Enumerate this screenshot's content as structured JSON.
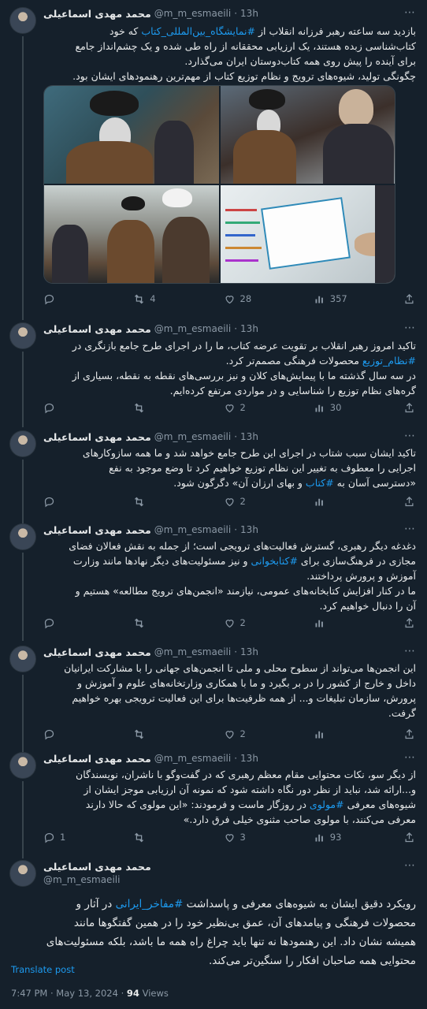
{
  "author": {
    "name": "محمد مهدی اسماعیلی",
    "handle": "@m_m_esmaeili"
  },
  "tweets": [
    {
      "time": "13h",
      "text_parts": [
        "بازدید سه ساعته رهبر فرزانه انقلاب از ",
        "#نمایشگاه_بین‌المللی_کتاب",
        " که خود\nکتاب‌شناسی زبده هستند، یک ارزیابی محققانه از راه طی شده و یک چشم‌انداز جامع\nبرای آینده را پیش روی همه کتاب‌دوستان ایران می‌گذارد.\nچگونگی تولید، شیوه‌های ترویج و نظام توزیع کتاب از مهم‌ترین رهنمودهای ایشان بود."
      ],
      "replies": "",
      "retweets": "4",
      "likes": "28",
      "views": "357"
    },
    {
      "time": "13h",
      "text_parts": [
        "تاکید امروز رهبر انقلاب بر تقویت عرضه کتاب، ما را در اجرای طرح جامع بازنگری در\n",
        "#نظام_توزیع",
        " محصولات فرهنگی مصمم‌تر کرد.\nدر سه سال گذشته ما با پیمایش‌های کلان و نیز بررسی‌های نقطه به نقطه، بسیاری از\nگره‌های نظام توزیع را شناسایی و در مواردی مرتفع کرده‌ایم."
      ],
      "replies": "",
      "retweets": "",
      "likes": "2",
      "views": "30"
    },
    {
      "time": "13h",
      "text_parts": [
        "تاکید ایشان سبب شتاب در اجرای این طرح جامع خواهد شد و ما همه سازوکارهای\nاجرایی را معطوف به تغییر این نظام توزیع خواهیم کرد تا وضع موجود به نفع\n«دسترسی آسان به ",
        "#کتاب",
        " و بهای ارزان آن» دگرگون شود."
      ],
      "replies": "",
      "retweets": "",
      "likes": "2",
      "views": ""
    },
    {
      "time": "13h",
      "text_parts": [
        "دغدغه دیگر رهبری، گسترش فعالیت‌های ترویجی است؛ از جمله به نقش فعالان فضای\nمجازی در فرهنگ‌سازی برای ",
        "#کتابخوانی",
        " و نیز مسئولیت‌های دیگر نهادها مانند وزارت\nآموزش و پرورش پرداختند.\nما در کنار افزایش کتابخانه‌های عمومی، نیازمند «انجمن‌های ترویج مطالعه» هستیم و\nآن را دنبال خواهیم کرد."
      ],
      "replies": "",
      "retweets": "",
      "likes": "2",
      "views": ""
    },
    {
      "time": "13h",
      "text_parts": [
        "این انجمن‌ها می‌تواند از سطوح محلی و ملی تا انجمن‌های جهانی را با مشارکت ایرانیان\nداخل و خارج از کشور را در بر بگیرد و ما با همکاری وزارتخانه‌های علوم و آموزش و\nپرورش، سازمان تبلیغات و... از همه ظرفیت‌ها برای این فعالیت ترویجی بهره خواهیم\nگرفت."
      ],
      "replies": "",
      "retweets": "",
      "likes": "2",
      "views": ""
    },
    {
      "time": "13h",
      "text_parts": [
        "از دیگر سو، نکات محتوایی مقام معظم رهبری که در گفت‌وگو با ناشران، نویسندگان\nو...ارائه شد، نباید از نظر دور نگاه داشته شود که نمونه آن ارزیابی موجز ایشان از\nشیوه‌های معرفی ",
        "#مولوی",
        " در روزگار ماست و فرمودند: «این مولوی که حالا دارند\nمعرفی می‌کنند، با مولوی صاحب مثنوی خیلی فرق دارد.»"
      ],
      "replies": "1",
      "retweets": "",
      "likes": "3",
      "views": "93"
    }
  ],
  "main_tweet": {
    "text_parts": [
      "رویکرد دقیق ایشان به شیوه‌های معرفی و پاسداشت ",
      "#مفاخر_ایرانی",
      " در آثار و\nمحصولات فرهنگی و پیامدهای آن، عمق بی‌نظیر خود را در همین گفتگوها مانند\nهمیشه نشان داد. این رهنمودها نه تنها باید چراغ راه همه ما باشد، بلکه مسئولیت‌های\nمحتوایی همه صاحبان افکار را سنگین‌تر می‌کند."
    ],
    "translate_label": "Translate post",
    "timestamp": "7:47 PM · May 13, 2024 · ",
    "views_count": "94",
    "views_label": " Views"
  },
  "icons": {
    "reply": "reply-icon",
    "retweet": "retweet-icon",
    "like": "heart-icon",
    "views": "views-icon",
    "share": "bookmark-share-icon",
    "more": "more-icon"
  },
  "colors": {
    "background": "#15202b",
    "accent": "#1d9bf0",
    "muted": "#8b98a5",
    "border": "#38444d"
  }
}
